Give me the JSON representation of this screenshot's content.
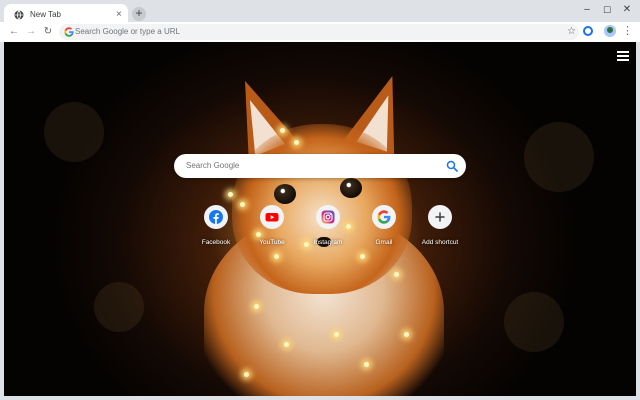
{
  "tab": {
    "title": "New Tab",
    "favicon": "globe-icon",
    "close_glyph": "×"
  },
  "newtab": {
    "glyph": "+"
  },
  "window": {
    "minimize": "–",
    "maximize": "☐",
    "close": "✕"
  },
  "toolbar": {
    "back": "←",
    "forward": "→",
    "reload": "↻",
    "omnibox_placeholder": "Search Google or type a URL",
    "star": "☆",
    "menu": "⋮"
  },
  "ntp": {
    "search_placeholder": "Search Google",
    "shortcuts": [
      {
        "label": "Facebook",
        "icon": "facebook-icon",
        "color": "#1877f2"
      },
      {
        "label": "YouTube",
        "icon": "youtube-icon",
        "color": "#ff0000"
      },
      {
        "label": "Instagram",
        "icon": "instagram-icon",
        "color": "#c13584"
      },
      {
        "label": "Gmail",
        "icon": "google-icon",
        "color": "#4285f4"
      },
      {
        "label": "Add shortcut",
        "icon": "plus-icon",
        "color": "#3c4043"
      }
    ]
  },
  "colors": {
    "accent": "#1a73e8",
    "tabstrip": "#dee1e6"
  }
}
